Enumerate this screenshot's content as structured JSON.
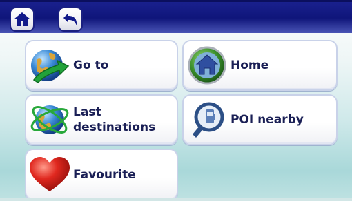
{
  "topbar": {
    "home_icon": "home-icon",
    "back_icon": "back-arrow-icon"
  },
  "menu": {
    "items": [
      {
        "label": "Go to",
        "icon": "globe-arrow-icon"
      },
      {
        "label": "Home",
        "icon": "home-badge-icon"
      },
      {
        "label": "Last\ndestinations",
        "icon": "globe-orbit-icon"
      },
      {
        "label": "POI nearby",
        "icon": "poi-magnifier-icon"
      },
      {
        "label": "Favourite",
        "icon": "heart-icon"
      }
    ]
  },
  "colors": {
    "header": "#0f157a",
    "label": "#1a1f55",
    "heart": "#e0281f",
    "globe": "#2e78c8",
    "arrow": "#22a23a",
    "home_badge": "#3b8f2c",
    "poi": "#2c4f86"
  }
}
